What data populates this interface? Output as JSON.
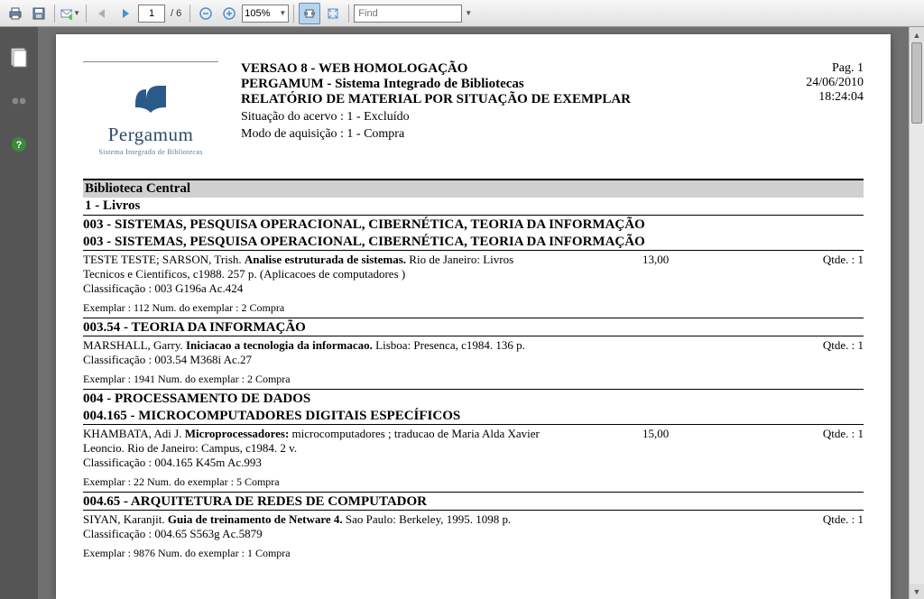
{
  "toolbar": {
    "page_current": "1",
    "page_total": "/ 6",
    "zoom": "105%",
    "find_placeholder": "Find"
  },
  "header": {
    "title1": "VERSAO 8 - WEB HOMOLOGAÇÃO",
    "title2": "PERGAMUM - Sistema Integrado de Bibliotecas",
    "title3": "RELATÓRIO DE MATERIAL POR SITUAÇÃO DE EXEMPLAR",
    "situacao": "Situação do acervo : 1 - Excluído",
    "modo": "Modo de aquisição : 1 - Compra",
    "page_label": "Pag. 1",
    "date": "24/06/2010",
    "time": "18:24:04",
    "logo_text": "Pergamum",
    "logo_sub": "Sistema Integrado de Bibliotecas"
  },
  "body": {
    "library": "Biblioteca Central",
    "type": "1 - Livros",
    "cat1": "003 - SISTEMAS, PESQUISA OPERACIONAL, CIBERNÉTICA, TEORIA DA INFORMAÇÃO",
    "cat1b": "003 - SISTEMAS, PESQUISA OPERACIONAL, CIBERNÉTICA, TEORIA DA INFORMAÇÃO",
    "e1_authors": "TESTE TESTE;  SARSON, Trish.   ",
    "e1_title": "Analise estruturada de sistemas.",
    "e1_pub": "      Rio de Janeiro:  Livros Tecnicos e Cientificos,  c1988.  257 p.   (Aplicacoes de computadores )",
    "e1_class": "Classificação : 003 G196a  Ac.424",
    "e1_price": "13,00",
    "e1_qty": "Qtde. : 1",
    "e1_ex": "Exemplar : 112 Num. do exemplar : 2  Compra",
    "cat2": "003.54 - TEORIA DA INFORMAÇÃO",
    "e2_authors": "MARSHALL, Garry.   ",
    "e2_title": "Iniciacao a tecnologia da informacao.",
    "e2_pub": "      Lisboa:  Presenca,  c1984.  136 p.",
    "e2_class": "Classificação : 003.54 M368i  Ac.27",
    "e2_qty": "Qtde. : 1",
    "e2_ex": "Exemplar : 1941 Num. do exemplar : 2  Compra",
    "cat3": "004 - PROCESSAMENTO DE DADOS",
    "cat3b": "004.165 - MICROCOMPUTADORES DIGITAIS ESPECÍFICOS",
    "e3_authors": "KHAMBATA, Adi J.   ",
    "e3_title": "Microprocessadores:",
    "e3_pub": "    microcomputadores ; traducao de Maria Alda Xavier Leoncio.     Rio de Janeiro:  Campus,  c1984.  2 v.",
    "e3_class": "Classificação : 004.165 K45m  Ac.993",
    "e3_price": "15,00",
    "e3_qty": "Qtde. : 1",
    "e3_ex": "Exemplar : 22 Num. do exemplar : 5  Compra",
    "cat4": "004.65 - ARQUITETURA DE REDES DE COMPUTADOR",
    "e4_authors": "SIYAN, Karanjit.   ",
    "e4_title": "Guia de treinamento de Netware 4.",
    "e4_pub": "      Sao Paulo:  Berkeley,  1995.  1098 p.",
    "e4_class": "Classificação : 004.65 S563g  Ac.5879",
    "e4_qty": "Qtde. : 1",
    "e4_ex": "Exemplar : 9876 Num. do exemplar : 1  Compra"
  }
}
